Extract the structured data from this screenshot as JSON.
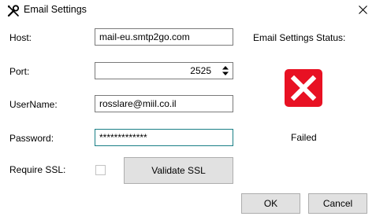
{
  "window": {
    "title": "Email Settings",
    "icon": "wrench-screwdriver-icon",
    "close_icon": "close-icon"
  },
  "form": {
    "host_label": "Host:",
    "host_value": "mail-eu.smtp2go.com",
    "port_label": "Port:",
    "port_value": "2525",
    "username_label": "UserName:",
    "username_value": "rosslare@miil.co.il",
    "password_label": "Password:",
    "password_value": "*************",
    "require_ssl_label": "Require SSL:",
    "require_ssl_checked": false,
    "validate_ssl_label": "Validate SSL"
  },
  "status": {
    "heading": "Email Settings Status:",
    "icon": "error-x-icon",
    "icon_color": "#e81123",
    "text": "Failed"
  },
  "buttons": {
    "ok_label": "OK",
    "cancel_label": "Cancel"
  },
  "colors": {
    "focus_border": "#1a7f86",
    "button_bg": "#e1e1e1"
  }
}
